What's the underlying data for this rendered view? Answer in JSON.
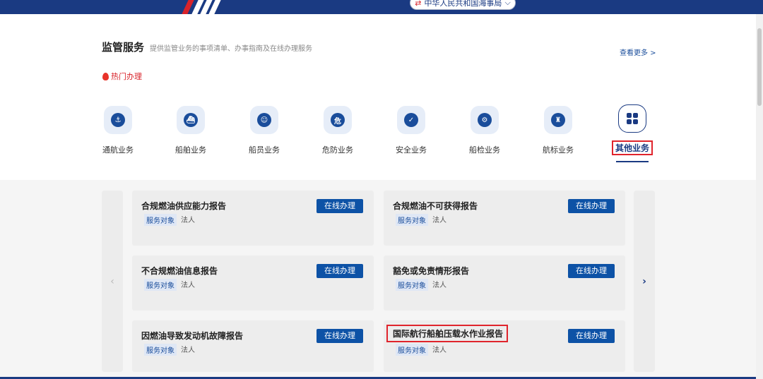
{
  "header": {
    "site_selector": "中华人民共和国海事局",
    "swap_icon": "swap-arrows-icon",
    "chevron_icon": "chevron-down-icon"
  },
  "section": {
    "title": "监管服务",
    "subtitle": "提供监管业务的事项清单、办事指南及在线办理服务",
    "more_link": "查看更多 >",
    "hot_label": "热门办理"
  },
  "categories": [
    {
      "label": "通航业务",
      "icon": "anchor-icon",
      "glyph": "⚓"
    },
    {
      "label": "船舶业务",
      "icon": "ship-icon",
      "glyph": "⛴"
    },
    {
      "label": "船员业务",
      "icon": "crew-icon",
      "glyph": "☺"
    },
    {
      "label": "危防业务",
      "icon": "hazard-icon",
      "glyph": "危"
    },
    {
      "label": "安全业务",
      "icon": "shield-check-icon",
      "glyph": "✓"
    },
    {
      "label": "船检业务",
      "icon": "ship-inspection-icon",
      "glyph": "⚙"
    },
    {
      "label": "航标业务",
      "icon": "lighthouse-icon",
      "glyph": "♜"
    },
    {
      "label": "其他业务",
      "icon": "grid-icon",
      "glyph": ""
    }
  ],
  "cards": [
    {
      "title": "合规燃油供应能力报告",
      "tag": "服务对象",
      "target": "法人",
      "button": "在线办理"
    },
    {
      "title": "合规燃油不可获得报告",
      "tag": "服务对象",
      "target": "法人",
      "button": "在线办理"
    },
    {
      "title": "不合规燃油信息报告",
      "tag": "服务对象",
      "target": "法人",
      "button": "在线办理"
    },
    {
      "title": "豁免或免责情形报告",
      "tag": "服务对象",
      "target": "法人",
      "button": "在线办理"
    },
    {
      "title": "因燃油导致发动机故障报告",
      "tag": "服务对象",
      "target": "法人",
      "button": "在线办理"
    },
    {
      "title": "国际航行船舶压载水作业报告",
      "tag": "服务对象",
      "target": "法人",
      "button": "在线办理"
    }
  ],
  "carousel": {
    "prev": "‹",
    "next": "›"
  },
  "colors": {
    "brand_navy": "#1a3a82",
    "button_blue": "#0d52a6",
    "highlight_red": "#e0242c",
    "hot_red": "#d8232a"
  }
}
